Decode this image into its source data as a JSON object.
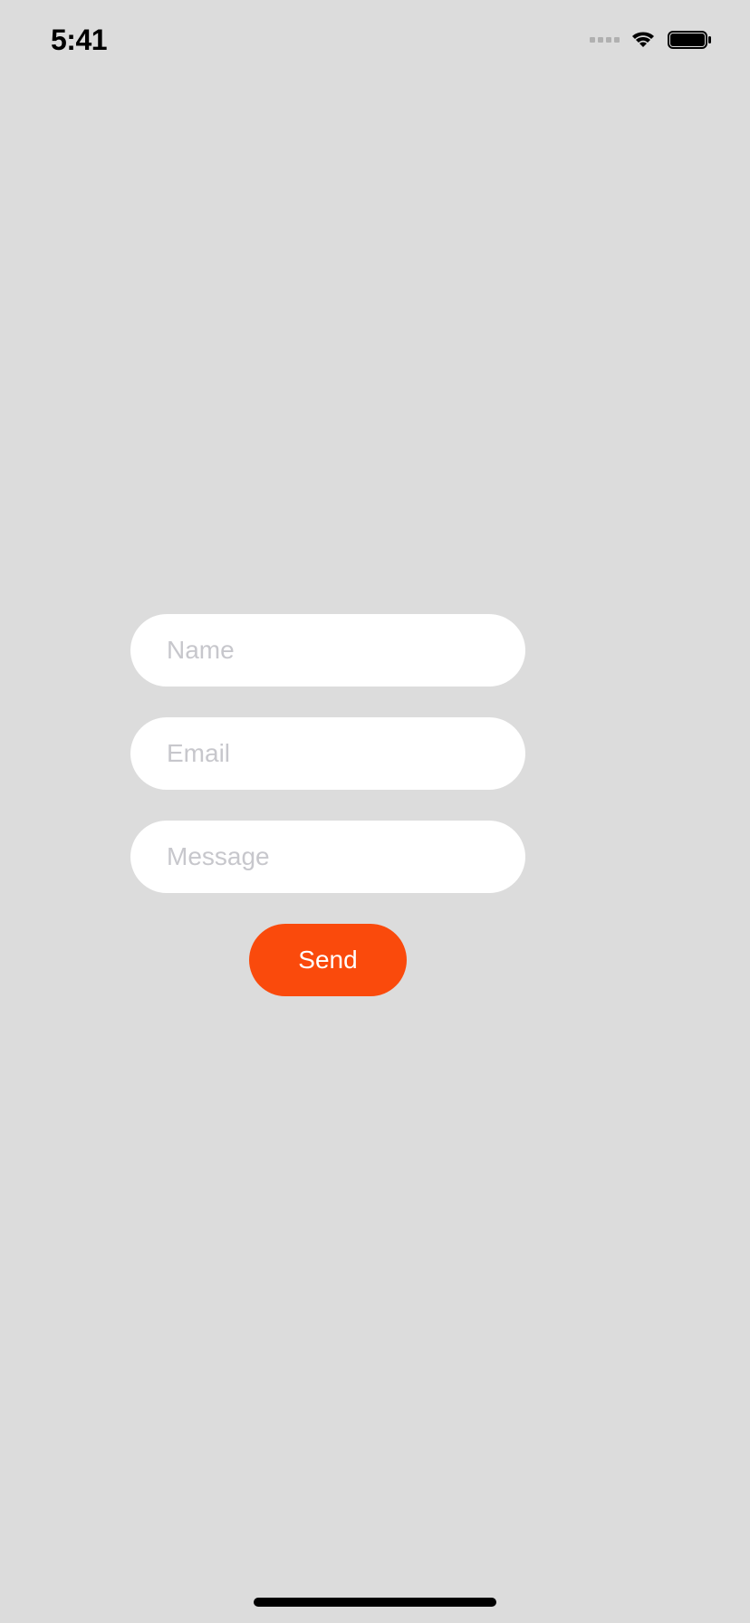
{
  "status_bar": {
    "time": "5:41"
  },
  "form": {
    "name": {
      "placeholder": "Name",
      "value": ""
    },
    "email": {
      "placeholder": "Email",
      "value": ""
    },
    "message": {
      "placeholder": "Message",
      "value": ""
    },
    "send_label": "Send"
  },
  "colors": {
    "accent": "#fa4a0c",
    "background": "#dcdcdc",
    "input_bg": "#ffffff",
    "placeholder": "#c7c7cc"
  }
}
